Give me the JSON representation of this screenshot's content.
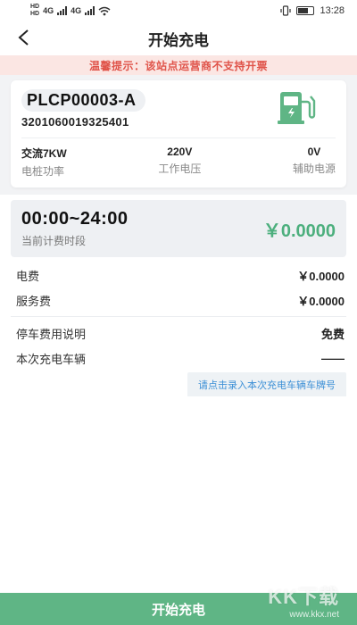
{
  "status_bar": {
    "sim1": "HD",
    "sim2": "HD",
    "net1": "4G",
    "net2": "4G",
    "time": "13:28",
    "battery_level": 60
  },
  "header": {
    "back_icon": "chevron-left-icon",
    "title": "开始充电"
  },
  "notice": {
    "text": "温馨提示：该站点运营商不支持开票",
    "color": "#e0544a"
  },
  "pile": {
    "code": "PLCP00003-A",
    "serial": "3201060019325401",
    "icon": "charging-pile-icon",
    "icon_color": "#5fb585",
    "specs": [
      {
        "value": "交流7KW",
        "label": "电桩功率"
      },
      {
        "value": "220V",
        "label": "工作电压"
      },
      {
        "value": "0V",
        "label": "辅助电源"
      }
    ]
  },
  "fee": {
    "period_time": "00:00~24:00",
    "period_label": "当前计费时段",
    "period_price": "￥0.0000",
    "rows": [
      {
        "label": "电费",
        "value": "￥0.0000"
      },
      {
        "label": "服务费",
        "value": "￥0.0000"
      }
    ],
    "parking_label": "停车费用说明",
    "parking_value": "免费",
    "vehicle_label": "本次充电车辆",
    "vehicle_value": "——",
    "vehicle_tip": "请点击录入本次充电车辆车牌号"
  },
  "start_button": {
    "label": "开始充电",
    "color": "#5fb585"
  },
  "watermark": {
    "brand": "KK下载",
    "url": "www.kkx.net"
  }
}
